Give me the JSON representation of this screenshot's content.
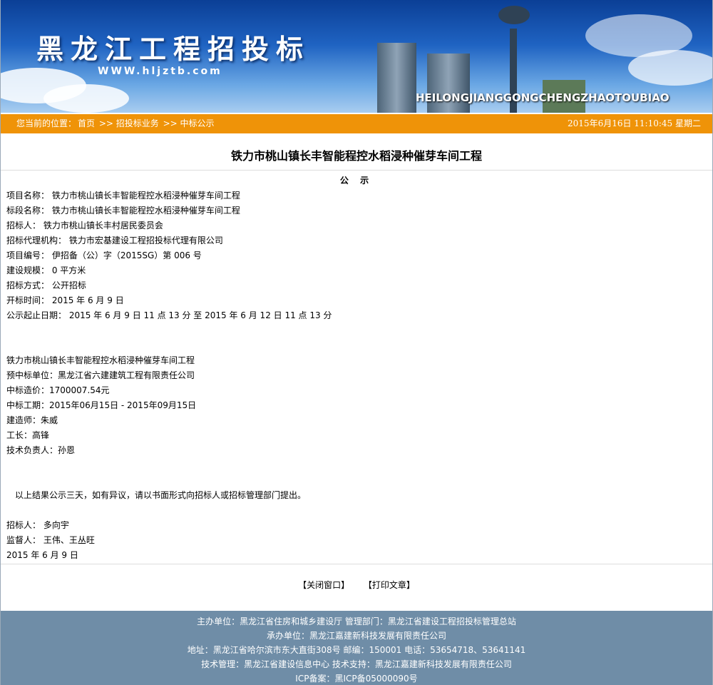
{
  "header": {
    "site_title": "黑龙江工程招投标",
    "site_url": "WWW.hljztb.com",
    "pinyin": "HEILONGJIANGGONGCHENGZHAOTOUBIAO"
  },
  "navbar": {
    "location_prefix": "您当前的位置：",
    "crumbs": [
      "首页",
      ">> 招投标业务",
      ">> 中标公示"
    ],
    "datetime": "2015年6月16日 11:10:45 星期二"
  },
  "article": {
    "title": "铁力市桃山镇长丰智能程控水稻浸种催芽车间工程",
    "subtitle": "公 示",
    "fields": [
      "项目名称： 铁力市桃山镇长丰智能程控水稻浸种催芽车间工程",
      "标段名称： 铁力市桃山镇长丰智能程控水稻浸种催芽车间工程",
      "招标人： 铁力市桃山镇长丰村居民委员会",
      "招标代理机构： 铁力市宏基建设工程招投标代理有限公司",
      "项目编号： 伊招备（公）字（2015SG）第 006 号",
      "建设规模： 0 平方米",
      "招标方式： 公开招标",
      "开标时间： 2015 年 6 月 9 日",
      "公示起止日期： 2015 年 6 月 9 日 11 点 13 分 至 2015 年 6 月 12 日 11 点 13 分"
    ],
    "winner": [
      "铁力市桃山镇长丰智能程控水稻浸种催芽车间工程",
      "预中标单位：黑龙江省六建建筑工程有限责任公司",
      "中标造价：1700007.54元",
      "中标工期：2015年06月15日 - 2015年09月15日",
      "建造师：朱威",
      "工长：高锋",
      "技术负责人：孙恩"
    ],
    "notice": "以上结果公示三天，如有异议，请以书面形式向招标人或招标管理部门提出。",
    "signatures": [
      "招标人： 多向宇",
      "监督人： 王伟、王丛旺",
      "2015 年 6 月 9 日"
    ]
  },
  "actions": {
    "close_label": "【关闭窗口】",
    "print_label": "【打印文章】"
  },
  "footer": {
    "lines": [
      "主办单位：黑龙江省住房和城乡建设厅  管理部门：黑龙江省建设工程招投标管理总站",
      "承办单位：黑龙江嘉建新科技发展有限责任公司",
      "地址：黑龙江省哈尔滨市东大直街308号  邮编：150001  电话：53654718、53641141",
      "技术管理：黑龙江省建设信息中心  技术支持：黑龙江嘉建新科技发展有限责任公司",
      "ICP备案：黑ICP备05000090号"
    ]
  },
  "colors": {
    "navbar": "#ef9308",
    "footer": "#6f8da7",
    "banner": "#1f63c2"
  }
}
